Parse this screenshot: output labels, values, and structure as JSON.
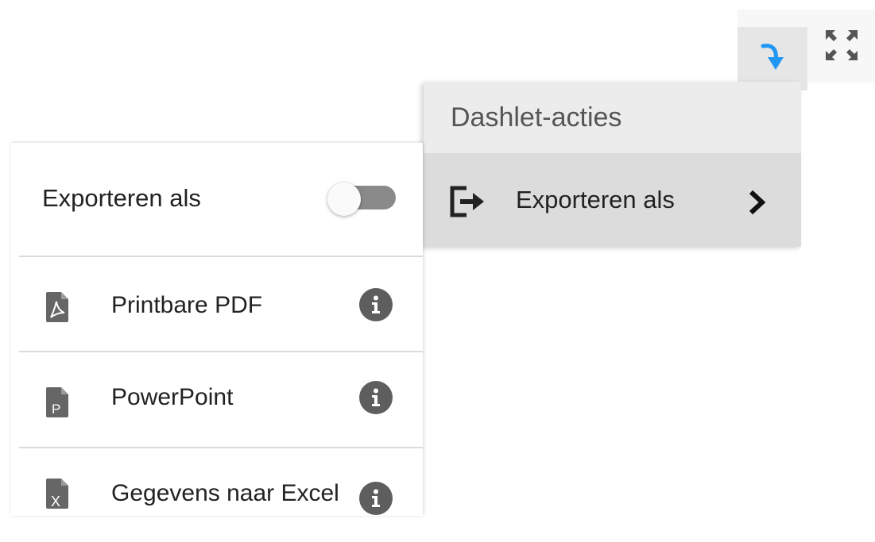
{
  "toolbar": {
    "action_icon": "curved-arrow-down-icon",
    "expand_icon": "expand-arrows-icon",
    "action_color": "#2196f3"
  },
  "actions_menu": {
    "header": "Dashlet-acties",
    "items": [
      {
        "label": "Exporteren als",
        "icon": "export-icon",
        "trailing_icon": "chevron-right-icon"
      }
    ]
  },
  "export_panel": {
    "title": "Exporteren als",
    "toggle_on": false,
    "options": [
      {
        "label": "Printbare PDF",
        "icon": "pdf-file-icon"
      },
      {
        "label": "PowerPoint",
        "icon": "powerpoint-file-icon"
      },
      {
        "label": "Gegevens naar Excel",
        "icon": "excel-file-icon"
      }
    ]
  }
}
